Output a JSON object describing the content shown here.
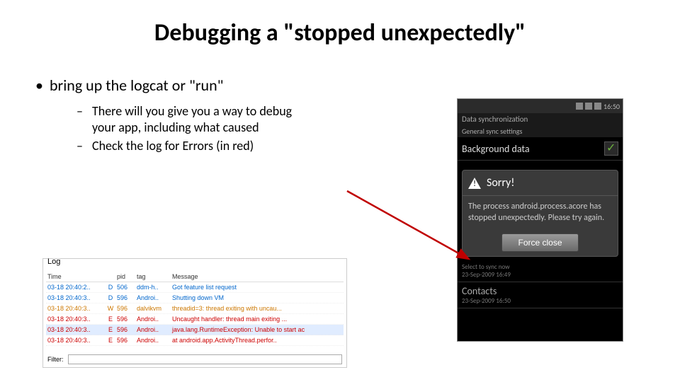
{
  "title": "Debugging a \"stopped unexpectedly\"",
  "bullets": {
    "main": "bring up the logcat or \"run\"",
    "sub1": "There will you give you a way to debug your app, including what caused",
    "sub2": "Check the log for Errors (in red)"
  },
  "phone": {
    "time": "16:50",
    "section1": "Data synchronization",
    "section2": "General sync settings",
    "row1": {
      "title": "Background data",
      "sub": ""
    },
    "dialog": {
      "title": "Sorry!",
      "body": "The process android.process.acore has stopped unexpectedly. Please try again.",
      "button": "Force close"
    },
    "below1": {
      "title": "",
      "sub1": "Select to sync now",
      "sub2": "23-Sep-2009 16:49"
    },
    "below2": {
      "title": "Contacts",
      "sub": "23-Sep-2009 16:50"
    }
  },
  "logcat": {
    "label": "Log",
    "headers": {
      "time": "Time",
      "lvl": "",
      "pid": "pid",
      "tag": "tag",
      "msg": "Message"
    },
    "rows": [
      {
        "time": "03-18 20:40:2..",
        "lvl": "D",
        "pid": "506",
        "tag": "ddm-h..",
        "msg": "Got feature list request",
        "cls": "lvl-D"
      },
      {
        "time": "03-18 20:40:3..",
        "lvl": "D",
        "pid": "596",
        "tag": "Androi..",
        "msg": "Shutting down VM",
        "cls": "lvl-D"
      },
      {
        "time": "03-18 20:40:3..",
        "lvl": "W",
        "pid": "596",
        "tag": "dalvikvm",
        "msg": "threadid=3: thread exiting with uncau...",
        "cls": "lvl-W"
      },
      {
        "time": "03-18 20:40:3..",
        "lvl": "E",
        "pid": "596",
        "tag": "Androi..",
        "msg": "Uncaught handler: thread main exiting ...",
        "cls": "lvl-E"
      },
      {
        "time": "03-18 20:40:3..",
        "lvl": "E",
        "pid": "596",
        "tag": "Androi..",
        "msg": "java.lang.RuntimeException: Unable to start ac",
        "cls": "lvl-E sel"
      },
      {
        "time": "03-18 20:40:3..",
        "lvl": "E",
        "pid": "596",
        "tag": "Androi..",
        "msg": "    at android.app.ActivityThread.perfor..",
        "cls": "lvl-E"
      }
    ],
    "filterLabel": "Filter:"
  }
}
